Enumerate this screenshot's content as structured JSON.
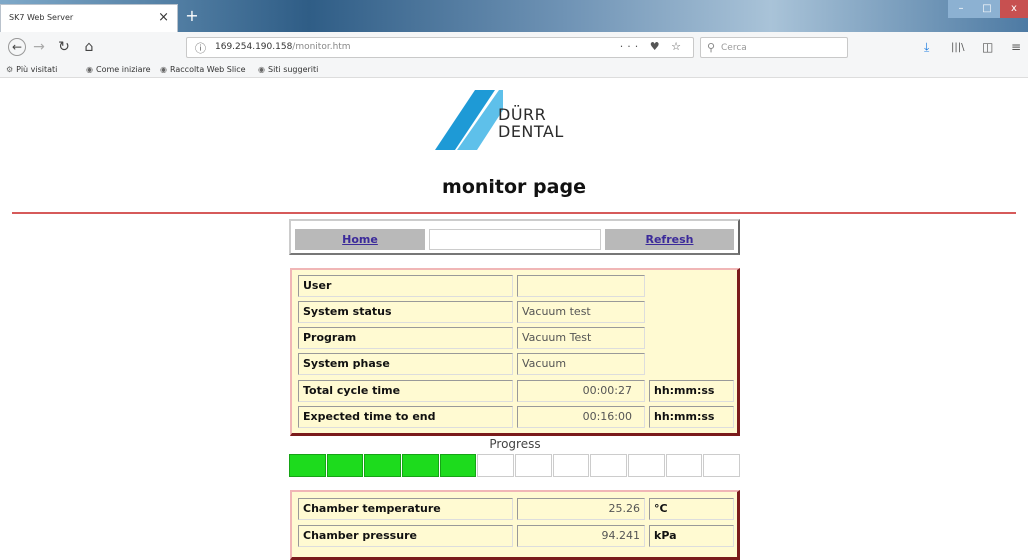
{
  "browser": {
    "tab_title": "SK7 Web Server",
    "tab_close": "×",
    "new_tab": "+",
    "url_host": "169.254.190.158",
    "url_path": "/monitor.htm",
    "url_icons": "··· ♥ ☆",
    "search_placeholder": "Cerca",
    "bookmarks": [
      "Più visitati",
      "Come iniziare",
      "Raccolta Web Slice",
      "Siti suggeriti"
    ]
  },
  "page": {
    "logo_line1": "DÜRR",
    "logo_line2": "DENTAL",
    "title": "monitor page",
    "nav": {
      "home": "Home",
      "refresh": "Refresh"
    }
  },
  "status_rows": [
    {
      "label": "User",
      "value": ""
    },
    {
      "label": "System status",
      "value": "Vacuum test"
    },
    {
      "label": "Program",
      "value": "Vacuum Test"
    },
    {
      "label": "System phase",
      "value": "Vacuum"
    },
    {
      "label": "Total cycle time",
      "value": "00:00:27",
      "unit": "hh:mm:ss"
    },
    {
      "label": "Expected time to end",
      "value": "00:16:00",
      "unit": "hh:mm:ss"
    }
  ],
  "progress": {
    "label": "Progress",
    "segments_total": 12,
    "segments_filled": 5,
    "fill_color": "#1ddb1d"
  },
  "measurements": [
    {
      "label": "Chamber temperature",
      "value": "25.26",
      "unit": "°C"
    },
    {
      "label": "Chamber pressure",
      "value": "94.241",
      "unit": "kPa"
    }
  ],
  "colors": {
    "accent_line": "#d65a5a",
    "panel_bg": "#fffad2",
    "logo_blue": "#1e9ad6"
  }
}
